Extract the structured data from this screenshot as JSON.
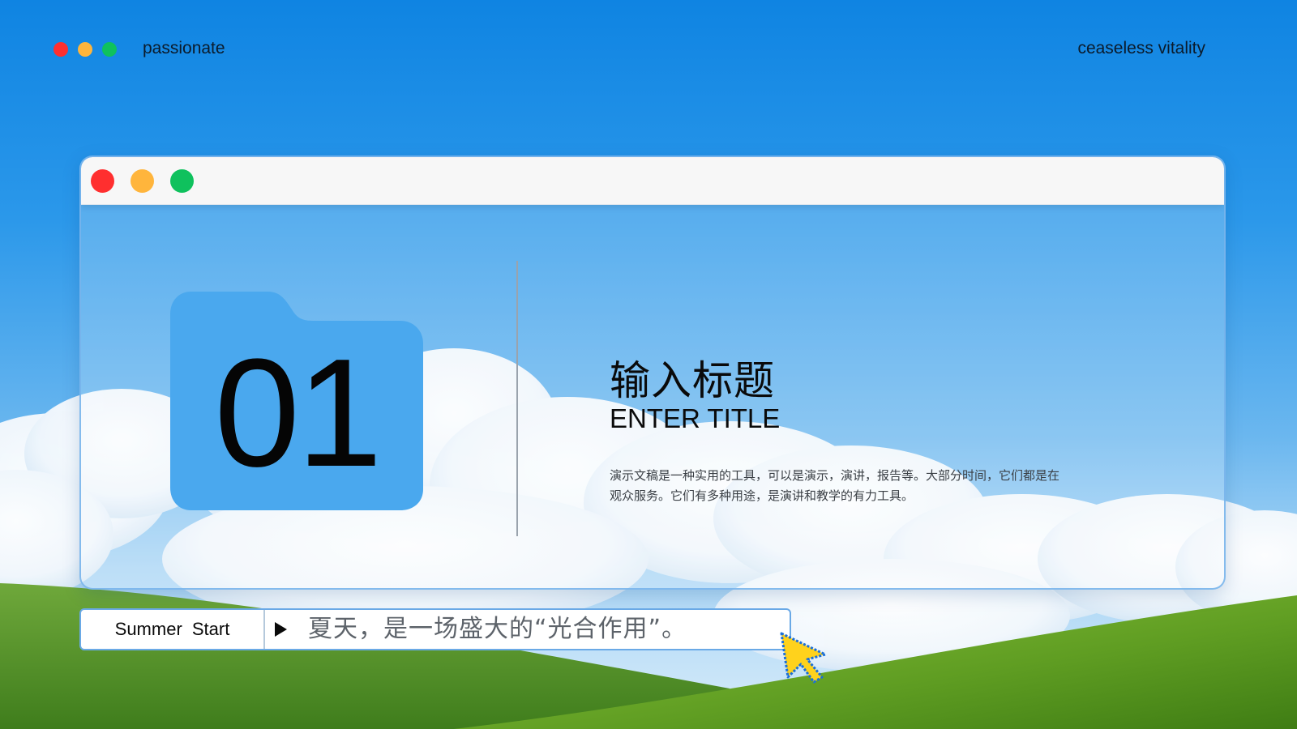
{
  "colors": {
    "dot_red": "#ff2f2f",
    "dot_yellow": "#ffb53c",
    "dot_green": "#0fc15d",
    "folder_blue": "#4aa8ee",
    "cursor_yellow": "#ffd21c",
    "cursor_outline": "#1b6fd8"
  },
  "header": {
    "left_label": "passionate",
    "right_label": "ceaseless vitality"
  },
  "window": {
    "number": "01",
    "title_cn": "输入标题",
    "title_en": "ENTER TITLE",
    "description": "演示文稿是一种实用的工具，可以是演示，演讲，报告等。大部分时间，它们都是在观众服务。它们有多种用途，是演讲和教学的有力工具。"
  },
  "bottom_bar": {
    "tag": "Summer Start",
    "quote": "夏天，是一场盛大的“光合作用”。"
  },
  "icons": {
    "folder": "folder-icon",
    "play": "play-icon",
    "cursor": "mouse-pointer-icon"
  }
}
